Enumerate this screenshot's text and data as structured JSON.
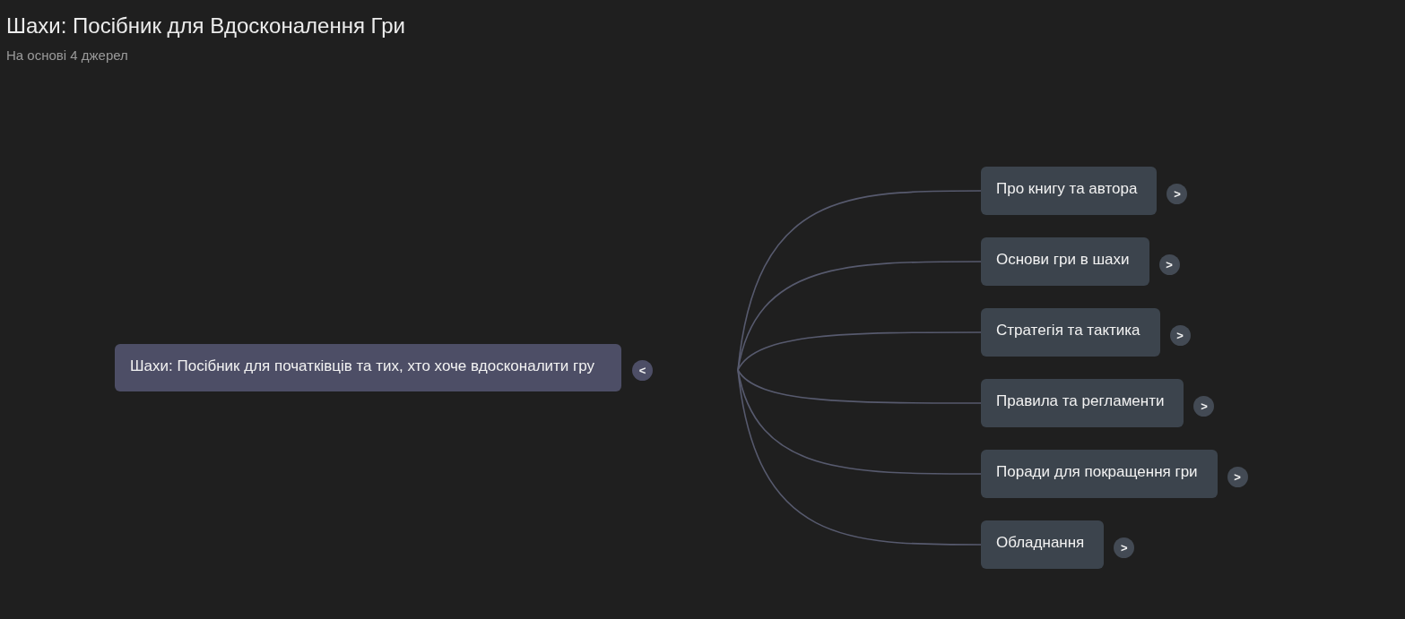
{
  "header": {
    "title": "Шахи: Посібник для Вдосконалення Гри",
    "subtitle": "На основі 4 джерел"
  },
  "mindmap": {
    "root": {
      "label": "Шахи: Посібник для початківців та тих, хто хоче вдосконалити гру",
      "toggle": "<",
      "expanded": true,
      "children": [
        {
          "label": "Про книгу та автора",
          "toggle": ">",
          "expanded": false
        },
        {
          "label": "Основи гри в шахи",
          "toggle": ">",
          "expanded": false
        },
        {
          "label": "Стратегія та тактика",
          "toggle": ">",
          "expanded": false
        },
        {
          "label": "Правила та регламенти",
          "toggle": ">",
          "expanded": false
        },
        {
          "label": "Поради для покращення гри",
          "toggle": ">",
          "expanded": false
        },
        {
          "label": "Обладнання",
          "toggle": ">",
          "expanded": false
        }
      ]
    }
  }
}
